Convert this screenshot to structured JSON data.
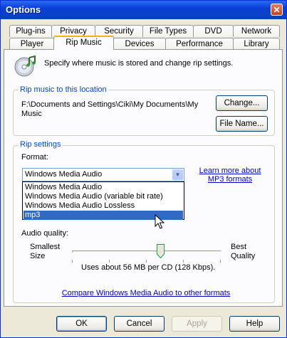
{
  "window": {
    "title": "Options",
    "close_glyph": "✕"
  },
  "tabs_row1": [
    "Plug-ins",
    "Privacy",
    "Security",
    "File Types",
    "DVD",
    "Network"
  ],
  "tabs_row2": [
    "Player",
    "Rip Music",
    "Devices",
    "Performance",
    "Library"
  ],
  "active_tab": "Rip Music",
  "header": {
    "description": "Specify where music is stored and change rip settings.",
    "icon": "cd-music-icon"
  },
  "location": {
    "group_title": "Rip music to this location",
    "path_line1": "F:\\Documents and Settings\\Ciki\\My Documents\\My",
    "path_line2": "Music",
    "change_button": "Change...",
    "filename_button": "File Name..."
  },
  "rip_settings": {
    "group_title": "Rip settings",
    "format_label": "Format:",
    "format_selected": "Windows Media Audio",
    "format_options": [
      "Windows Media Audio",
      "Windows Media Audio (variable bit rate)",
      "Windows Media Audio Lossless",
      "mp3"
    ],
    "highlighted_option": "mp3",
    "learn_more_line1": "Learn more about",
    "learn_more_line2": "MP3 formats",
    "audio_quality_label": "Audio quality:",
    "smallest_line1": "Smallest",
    "smallest_line2": "Size",
    "best_line1": "Best",
    "best_line2": "Quality",
    "usage_text": "Uses about 56 MB per CD (128 Kbps).",
    "slider_level": 0.55,
    "compare_link": "Compare Windows Media Audio to other formats"
  },
  "buttons": {
    "ok": "OK",
    "cancel": "Cancel",
    "apply": "Apply",
    "help": "Help"
  },
  "colors": {
    "title_bar": "#0a3fd3",
    "group_title": "#0046d5",
    "link": "#0000cc",
    "selection": "#316ac5",
    "active_tab_accent": "#f1b40d"
  }
}
